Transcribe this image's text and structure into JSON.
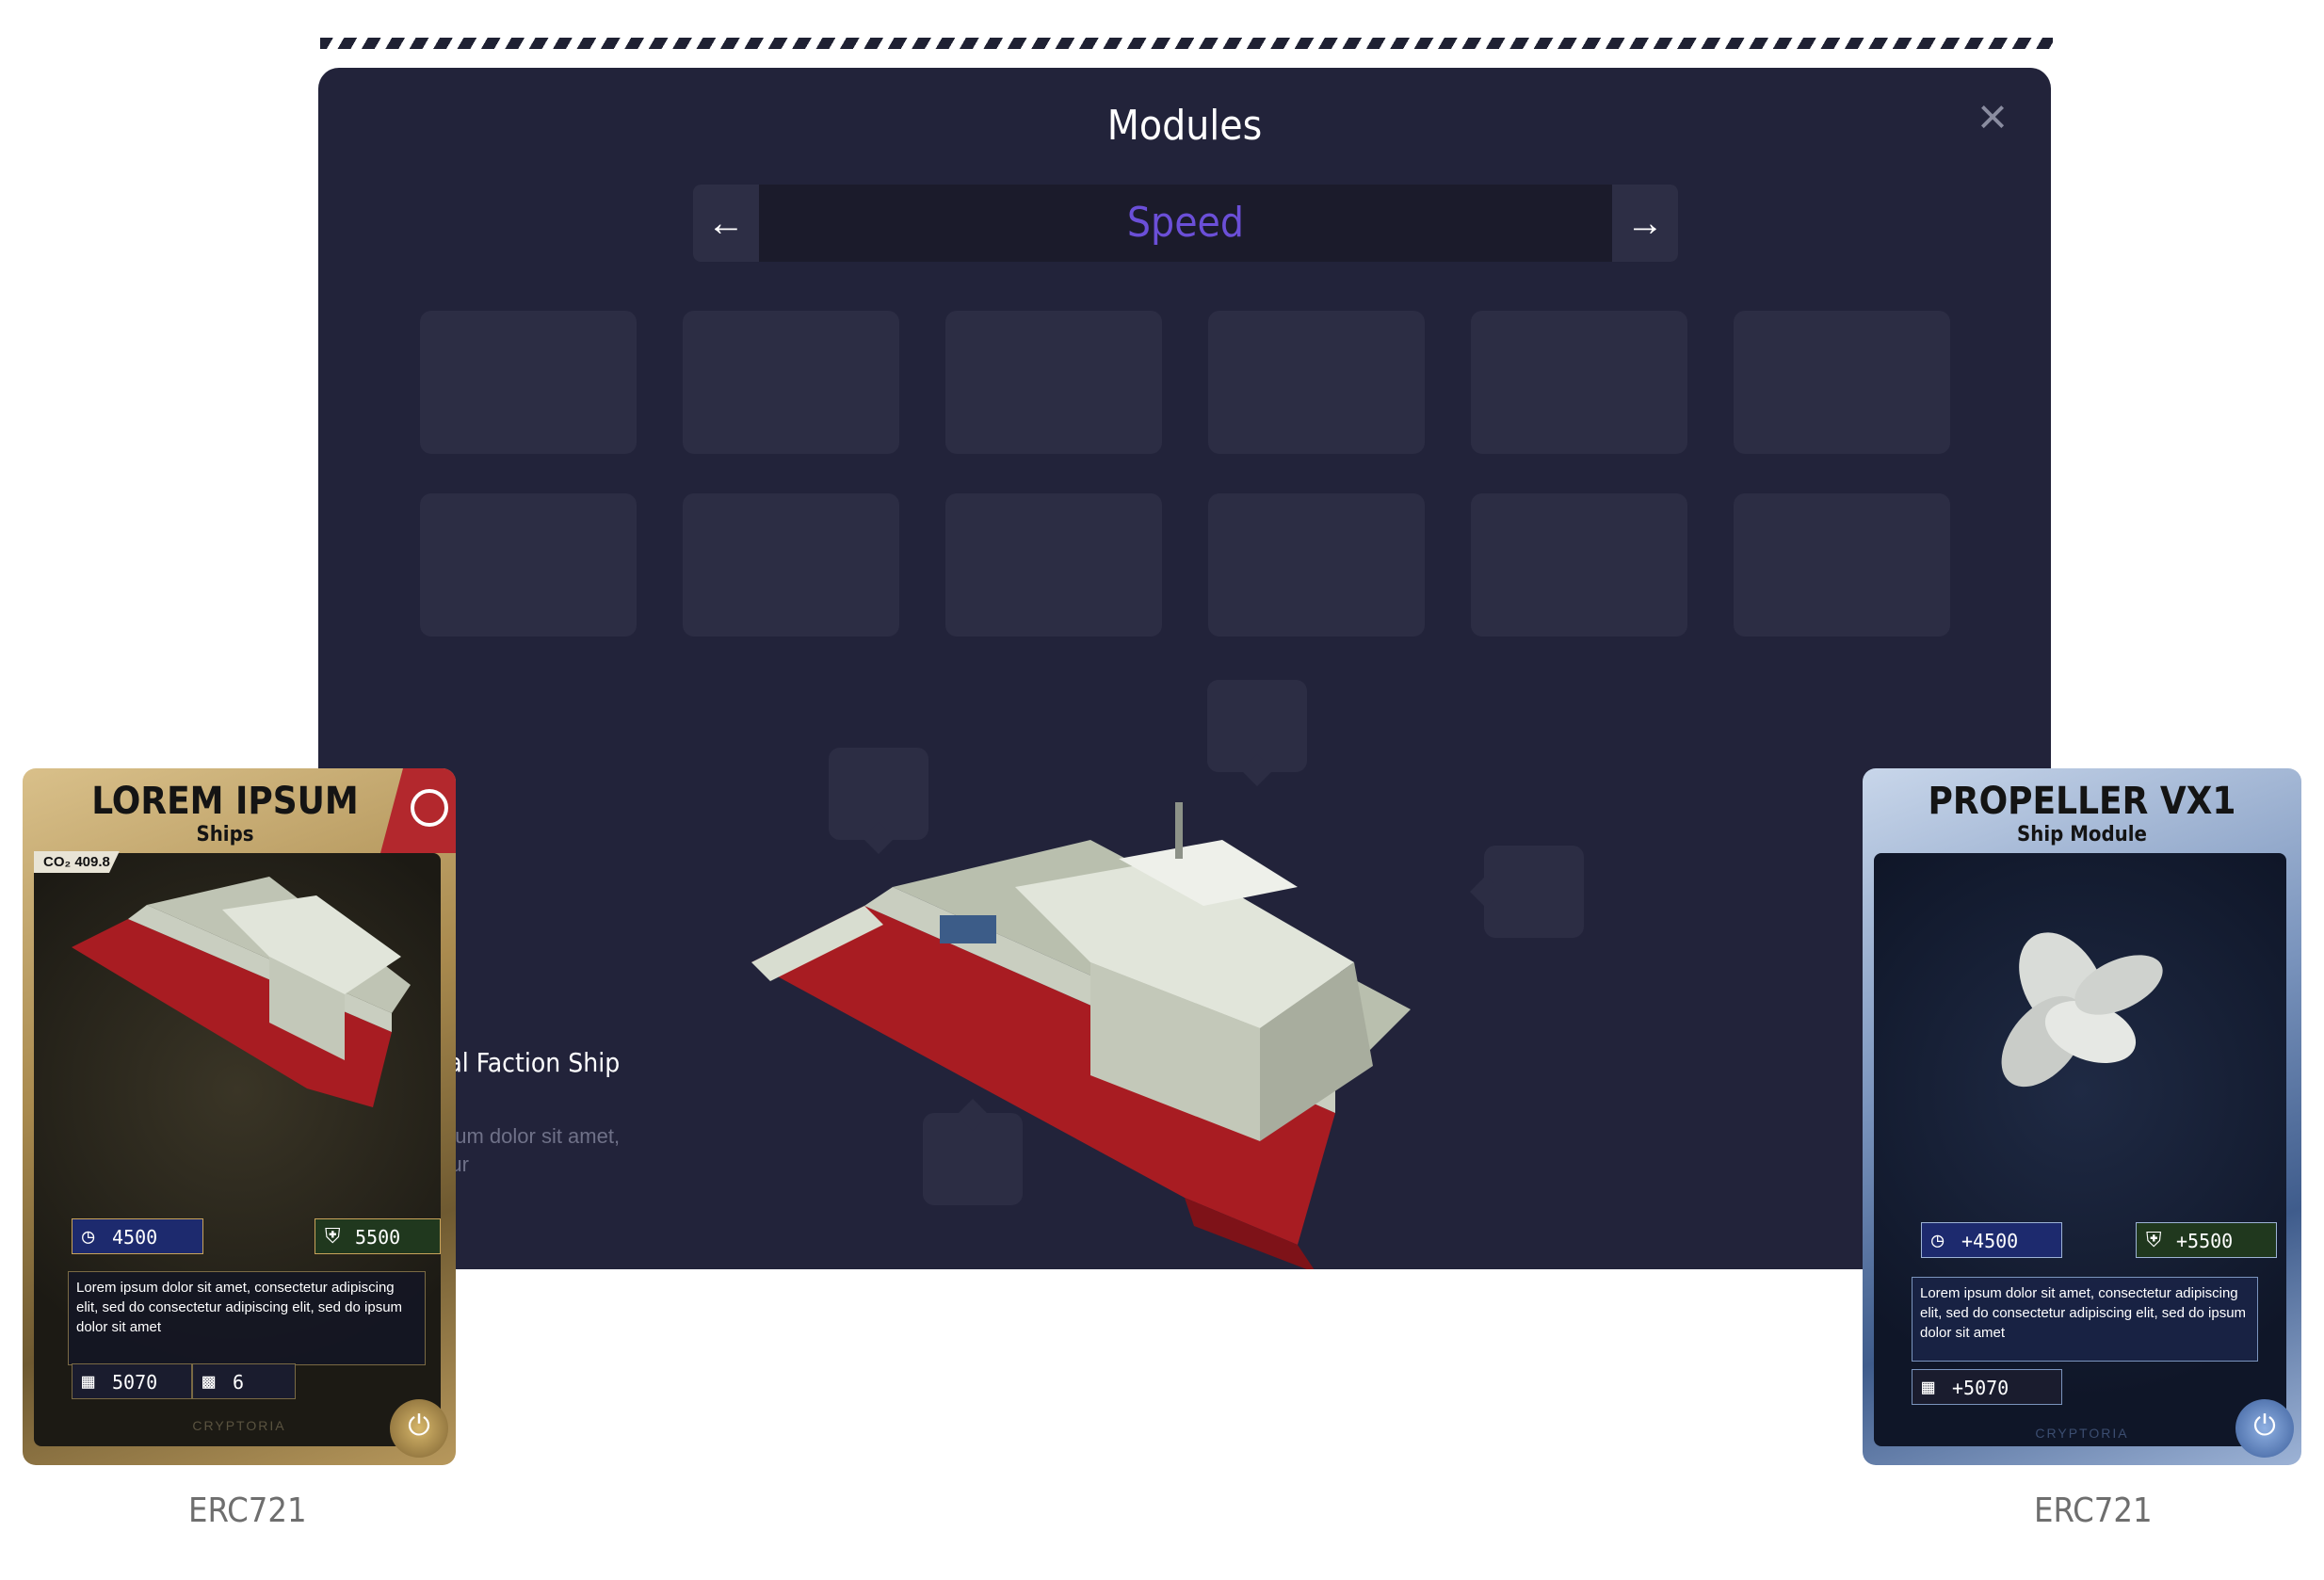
{
  "modal": {
    "title": "Modules",
    "close_icon": "×",
    "selector": {
      "value": "Speed",
      "prev_icon": "arrow-left-icon",
      "next_icon": "arrow-right-icon"
    },
    "slots_count": 12
  },
  "ship_info": {
    "name": "rial Faction Ship",
    "description": "psum dolor sit amet, etur"
  },
  "cards": {
    "ship": {
      "title": "LOREM IPSUM",
      "subtitle": "Ships",
      "co2_label": "CO₂",
      "co2_value": "409.8",
      "speed": "4500",
      "armor": "5500",
      "description": "Lorem ipsum dolor sit amet, consectetur adipiscing elit, sed do consectetur adipiscing elit, sed do ipsum dolor sit amet",
      "storage": "5070",
      "slots": "6",
      "brand": "CRYPTORIA",
      "standard": "ERC721",
      "accent": "#c9a35a"
    },
    "module": {
      "title": "PROPELLER VX1",
      "subtitle": "Ship Module",
      "speed": "+4500",
      "armor": "+5500",
      "description": "Lorem ipsum dolor sit amet, consectetur adipiscing elit, sed do consectetur adipiscing elit, sed do ipsum dolor sit amet",
      "storage": "+5070",
      "brand": "CRYPTORIA",
      "standard": "ERC721",
      "accent": "#9db3d6"
    }
  },
  "colors": {
    "panel": "#22233a",
    "slot": "#2c2d44",
    "selector_text": "#6b4fd8"
  }
}
